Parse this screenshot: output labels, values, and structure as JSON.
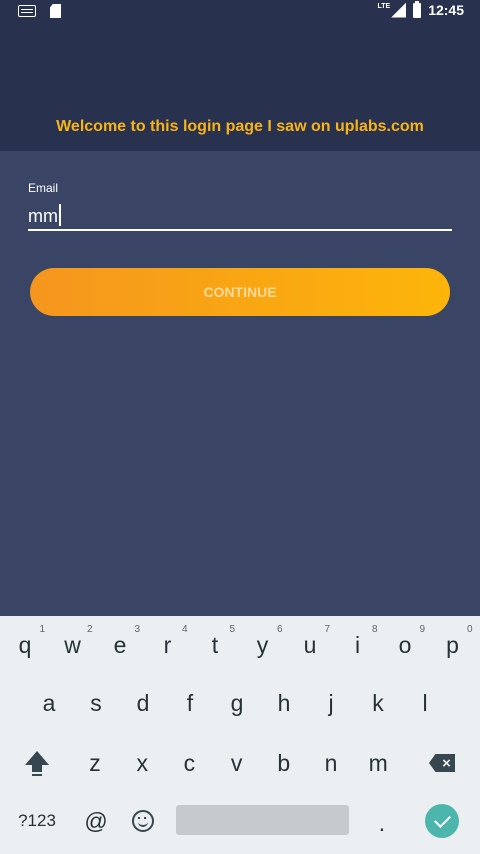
{
  "statusbar": {
    "network": "LTE",
    "time": "12:45"
  },
  "header": {
    "title": "Welcome to this login page I saw on uplabs.com"
  },
  "form": {
    "email_label": "Email",
    "email_value": "mm",
    "continue_label": "CONTINUE"
  },
  "keyboard": {
    "row1": [
      {
        "k": "q",
        "a": "1"
      },
      {
        "k": "w",
        "a": "2"
      },
      {
        "k": "e",
        "a": "3"
      },
      {
        "k": "r",
        "a": "4"
      },
      {
        "k": "t",
        "a": "5"
      },
      {
        "k": "y",
        "a": "6"
      },
      {
        "k": "u",
        "a": "7"
      },
      {
        "k": "i",
        "a": "8"
      },
      {
        "k": "o",
        "a": "9"
      },
      {
        "k": "p",
        "a": "0"
      }
    ],
    "row2": [
      "a",
      "s",
      "d",
      "f",
      "g",
      "h",
      "j",
      "k",
      "l"
    ],
    "row3": [
      "z",
      "x",
      "c",
      "v",
      "b",
      "n",
      "m"
    ],
    "symbols_label": "?123",
    "at_label": "@",
    "period_label": "."
  },
  "colors": {
    "accent": "#f9b316",
    "background": "#3a4566",
    "header": "#28324f",
    "enter": "#4db6ac"
  }
}
